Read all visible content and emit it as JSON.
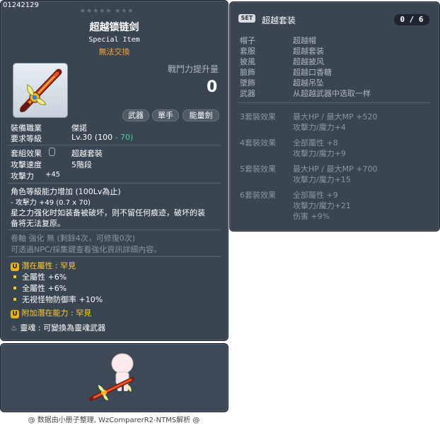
{
  "item": {
    "code": "01242129",
    "stars": "★★★★★  ★★★",
    "name": "超越锁链剑",
    "subtitle": "Special Item",
    "tradability": "無法交換",
    "power_label": "戰鬥力提升量",
    "power_value": "0",
    "buttons": [
      "武器",
      "單手",
      "能量劍"
    ],
    "job_label": "裝備職業",
    "job_value": "傑諾",
    "req_label": "要求等級",
    "req_value": "Lv.30 (100",
    "req_bonus": "- 70)",
    "set_label": "套組效果",
    "set_value": "超越套裝",
    "speed_label": "攻擊速度",
    "speed_value": "5階段",
    "atk_label": "攻擊力",
    "atk_value": "+45",
    "growth_title": "角色等級能力增加 (100Lv為止)",
    "growth_line": "- 攻擊力 +49 (0.7 x 70)",
    "desc_line1": "星之力强化时如装备被破坏，则不留任何痕迹，破坏的装",
    "desc_line2": "备将无法复原。",
    "scroll_line": "卷軸 強化 無 (剩餘4次，可修復0次)",
    "scroll_hint": "可透過NPC/採集鍵查看強化資訊詳細內容。",
    "potential_label": "潛在屬性",
    "potential_grade": ": 罕見",
    "potential_lines": [
      "全屬性 +6%",
      "全屬性 +6%",
      "无视怪物防御率 +10%"
    ],
    "additional_label": "附加潛在能力",
    "additional_grade": ": 罕見",
    "soul_label": "靈魂",
    "soul_value": ": 可變換為靈魂武器"
  },
  "set": {
    "badge": "SET",
    "name": "超越套装",
    "count": "0 / 6",
    "parts": [
      {
        "slot": "帽子",
        "item": "超越帽"
      },
      {
        "slot": "套服",
        "item": "超越套装"
      },
      {
        "slot": "披風",
        "item": "超越披风"
      },
      {
        "slot": "臉飾",
        "item": "超越口香糖"
      },
      {
        "slot": "墜飾",
        "item": "超越吊坠"
      },
      {
        "slot": "武器",
        "item": "从超越武器中选取一样"
      }
    ],
    "effects": [
      {
        "label": "3套裝效果",
        "lines": [
          "最大HP / 最大MP  +520",
          "攻擊力/魔力+4"
        ]
      },
      {
        "label": "4套裝效果",
        "lines": [
          "全部屬性 +8",
          "攻擊力/魔力+9"
        ]
      },
      {
        "label": "5套裝效果",
        "lines": [
          "最大HP / 最大MP  +700",
          "攻擊力/魔力+15"
        ]
      },
      {
        "label": "6套裝效果",
        "lines": [
          "全部屬性 +9",
          "攻擊力/魔力+21",
          "伤害 +9%"
        ]
      }
    ]
  },
  "footer": "@ 数据由小册子整理, WzComparerR2-NTMS解析 @",
  "colors": {
    "panel": "#3a4552",
    "untradeable": "#f7a23a",
    "bonus": "#3ed78a",
    "potential": "#ffcc33"
  }
}
